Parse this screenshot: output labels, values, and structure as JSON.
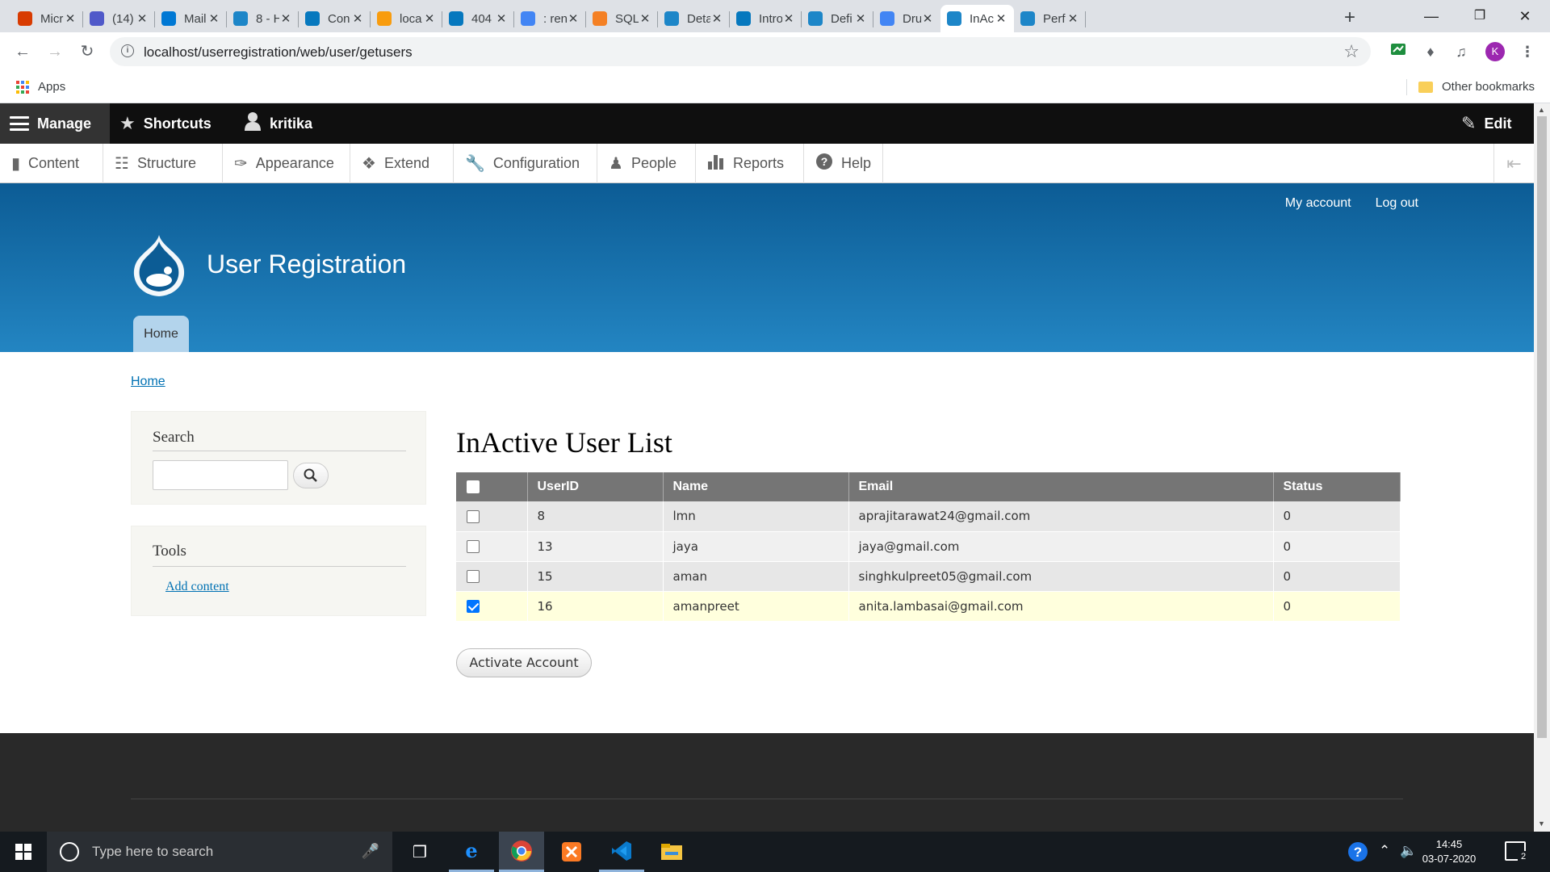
{
  "browser": {
    "tabs": [
      {
        "label": "Micr",
        "icon": "office-icon",
        "color": "#d83b01"
      },
      {
        "label": "(14)",
        "icon": "teams-icon",
        "color": "#5059c9"
      },
      {
        "label": "Mail",
        "icon": "outlook-icon",
        "color": "#0078d4"
      },
      {
        "label": "8 - H",
        "icon": "drupal-icon",
        "color": "#1d86c8"
      },
      {
        "label": "Con",
        "icon": "drupal-drop-icon",
        "color": "#0678be"
      },
      {
        "label": "loca",
        "icon": "phpmyadmin-icon",
        "color": "#f89c0e"
      },
      {
        "label": "404",
        "icon": "drupal-drop-icon",
        "color": "#0678be"
      },
      {
        "label": ": ren",
        "icon": "google-icon",
        "color": "#4285f4"
      },
      {
        "label": "SQL",
        "icon": "stackoverflow-icon",
        "color": "#f48024"
      },
      {
        "label": "Deta",
        "icon": "drupal-icon",
        "color": "#1d86c8"
      },
      {
        "label": "Intro",
        "icon": "drupal-drop-icon",
        "color": "#0678be"
      },
      {
        "label": "Defi",
        "icon": "drupal-icon",
        "color": "#1d86c8"
      },
      {
        "label": "Drup",
        "icon": "google-icon",
        "color": "#4285f4"
      },
      {
        "label": "InAc",
        "icon": "drupal-icon",
        "color": "#1d86c8"
      },
      {
        "label": "Perf",
        "icon": "drupal-icon",
        "color": "#1d86c8"
      }
    ],
    "url": "localhost/userregistration/web/user/getusers",
    "profile_initial": "K",
    "apps_label": "Apps",
    "other_bookmarks": "Other bookmarks"
  },
  "admin_toolbar": {
    "manage": "Manage",
    "shortcuts": "Shortcuts",
    "user": "kritika",
    "edit": "Edit",
    "tray": [
      "Content",
      "Structure",
      "Appearance",
      "Extend",
      "Configuration",
      "People",
      "Reports",
      "Help"
    ]
  },
  "header": {
    "my_account": "My account",
    "log_out": "Log out",
    "site_name": "User Registration",
    "home_tab": "Home"
  },
  "breadcrumb": "Home",
  "sidebar": {
    "search_title": "Search",
    "tools_title": "Tools",
    "add_content": "Add content"
  },
  "main": {
    "title": "InActive User List",
    "columns": [
      "UserID",
      "Name",
      "Email",
      "Status"
    ],
    "rows": [
      {
        "id": "8",
        "name": "lmn",
        "email": "aprajitarawat24@gmail.com",
        "status": "0",
        "checked": false
      },
      {
        "id": "13",
        "name": "jaya",
        "email": "jaya@gmail.com",
        "status": "0",
        "checked": false
      },
      {
        "id": "15",
        "name": "aman",
        "email": "singhkulpreet05@gmail.com",
        "status": "0",
        "checked": false
      },
      {
        "id": "16",
        "name": "amanpreet",
        "email": "anita.lambasai@gmail.com",
        "status": "0",
        "checked": true
      }
    ],
    "activate_button": "Activate Account"
  },
  "taskbar": {
    "search_placeholder": "Type here to search",
    "time": "14:45",
    "date": "03-07-2020",
    "notification_count": "2"
  }
}
